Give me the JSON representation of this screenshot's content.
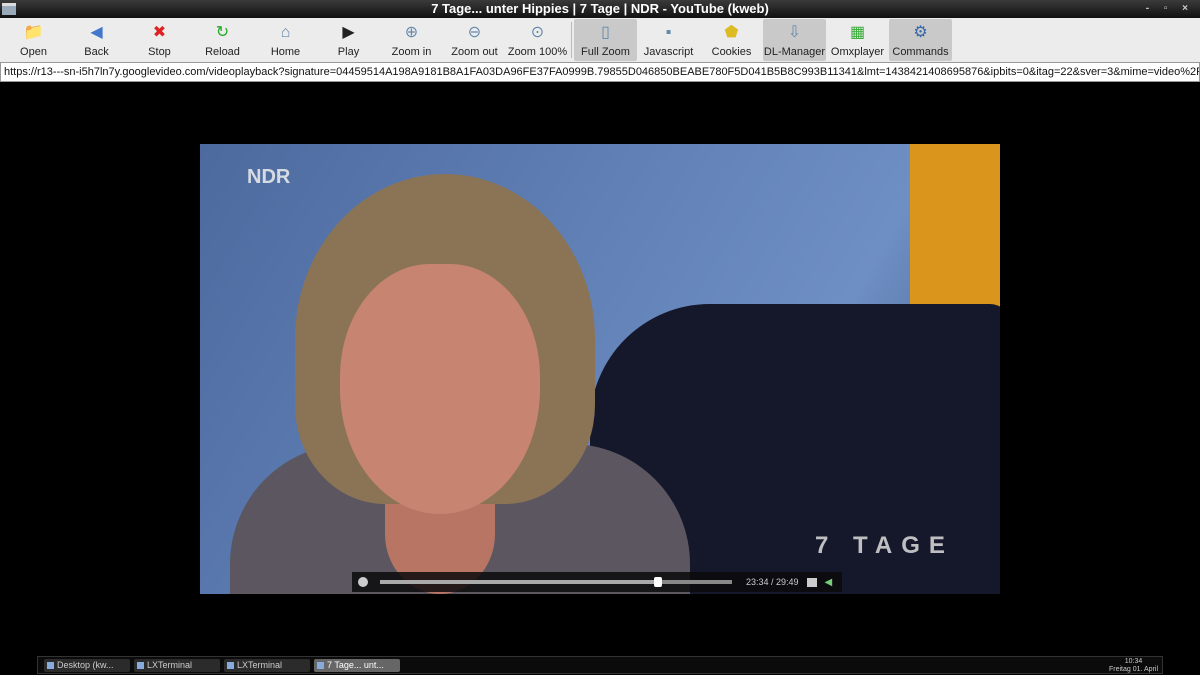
{
  "window": {
    "title": "7 Tage... unter Hippies | 7 Tage | NDR - YouTube (kweb)",
    "controls": "- ▫ ×"
  },
  "toolbar": [
    {
      "label": "Open",
      "icon": "folder-icon",
      "glyph": "📁",
      "active": false
    },
    {
      "label": "Back",
      "icon": "back-arrow-icon",
      "glyph": "◀",
      "active": false
    },
    {
      "label": "Stop",
      "icon": "stop-icon",
      "glyph": "✖",
      "active": false
    },
    {
      "label": "Reload",
      "icon": "reload-icon",
      "glyph": "↻",
      "active": false
    },
    {
      "label": "Home",
      "icon": "home-icon",
      "glyph": "⌂",
      "active": false
    },
    {
      "label": "Play",
      "icon": "play-icon",
      "glyph": "▶",
      "active": false
    },
    {
      "label": "Zoom in",
      "icon": "zoom-in-icon",
      "glyph": "⊕",
      "active": false
    },
    {
      "label": "Zoom out",
      "icon": "zoom-out-icon",
      "glyph": "⊖",
      "active": false
    },
    {
      "label": "Zoom 100%",
      "icon": "zoom-reset-icon",
      "glyph": "⊙",
      "active": false
    },
    {
      "label": "Full Zoom",
      "icon": "full-zoom-icon",
      "glyph": "▯",
      "active": true
    },
    {
      "label": "Javascript",
      "icon": "javascript-icon",
      "glyph": "▪",
      "active": false
    },
    {
      "label": "Cookies",
      "icon": "cookies-icon",
      "glyph": "⬟",
      "active": false
    },
    {
      "label": "DL-Manager",
      "icon": "download-icon",
      "glyph": "⇩",
      "active": true
    },
    {
      "label": "Omxplayer",
      "icon": "omxplayer-icon",
      "glyph": "▦",
      "active": false
    },
    {
      "label": "Commands",
      "icon": "gear-icon",
      "glyph": "⚙",
      "active": true
    }
  ],
  "url": "https://r13---sn-i5h7ln7y.googlevideo.com/videoplayback?signature=04459514A198A9181B8A1FA03DA96FE37FA0999B.79855D046850BEABE780F5D041B5B8C993B11341&lmt=1438421408695876&ipbits=0&itag=22&sver=3&mime=video%2Fmp4&requir",
  "video": {
    "logo": "NDR",
    "show_logo": "7 TAGE",
    "time": "23:34 / 29:49",
    "progress": 0.79
  },
  "taskbar": {
    "tasks": [
      {
        "label": "Desktop (kw...",
        "active": false
      },
      {
        "label": "LXTerminal",
        "active": false
      },
      {
        "label": "LXTerminal",
        "active": false
      },
      {
        "label": "7 Tage... unt...",
        "active": true
      }
    ],
    "clock_time": "10:34",
    "clock_date": "Freitag 01. April"
  }
}
